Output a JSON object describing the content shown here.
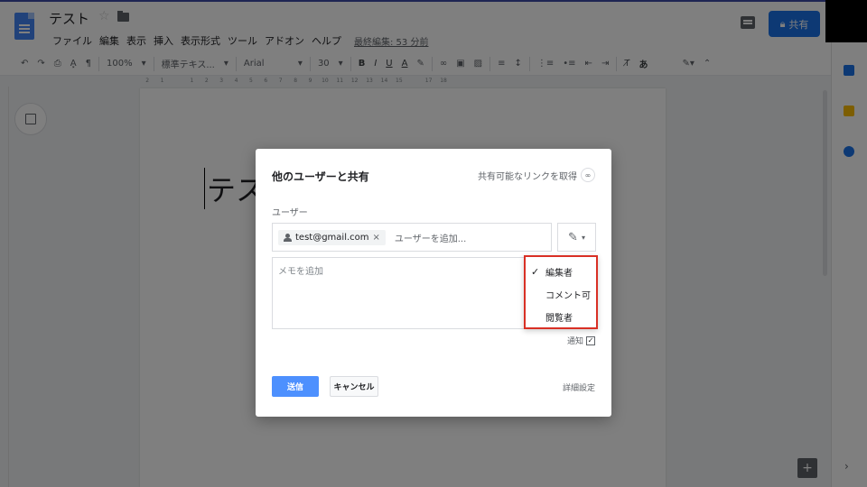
{
  "header": {
    "doc_title": "テスト",
    "menu": [
      "ファイル",
      "編集",
      "表示",
      "挿入",
      "表示形式",
      "ツール",
      "アドオン",
      "ヘルプ"
    ],
    "last_edit": "最終編集: 53 分前",
    "share_label": "共有",
    "share_icon": "lock-icon"
  },
  "toolbar": {
    "zoom": "100%",
    "style": "標準テキス...",
    "font": "Arial",
    "size": "30",
    "bold": "B",
    "italic": "I",
    "underline": "U",
    "text_color": "A",
    "input_tool": "あ"
  },
  "ruler": [
    "2",
    "1",
    "",
    "1",
    "2",
    "3",
    "4",
    "5",
    "6",
    "7",
    "8",
    "9",
    "10",
    "11",
    "12",
    "13",
    "14",
    "15",
    "",
    "17",
    "18"
  ],
  "document": {
    "text": "テス"
  },
  "dialog": {
    "title": "他のユーザーと共有",
    "get_link": "共有可能なリンクを取得",
    "users_label": "ユーザー",
    "chip_email": "test@gmail.com",
    "chip_remove": "×",
    "add_user_placeholder": "ユーザーを追加...",
    "memo_placeholder": "メモを追加",
    "notify_label": "通知",
    "notify_checked": "✓",
    "send_label": "送信",
    "cancel_label": "キャンセル",
    "advanced_label": "詳細設定"
  },
  "permission_menu": {
    "options": [
      {
        "label": "編集者",
        "check": "✓"
      },
      {
        "label": "コメント可",
        "check": ""
      },
      {
        "label": "閲覧者",
        "check": ""
      }
    ]
  },
  "colors": {
    "accent": "#1a73e8",
    "send": "#4d90fe",
    "highlight_border": "#d93025"
  }
}
